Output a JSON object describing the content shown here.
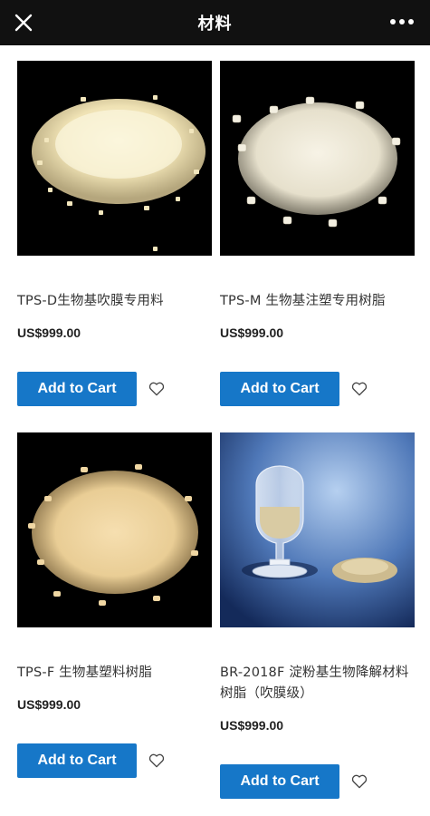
{
  "header": {
    "title": "材料",
    "close_icon": "close-icon",
    "more_icon": "more-horizontal-icon"
  },
  "products": [
    {
      "name": "TPS-D生物基吹膜专用料",
      "price": "US$999.00",
      "button": "Add to Cart",
      "image": "ivory-pellets-on-black"
    },
    {
      "name": "TPS-M 生物基注塑专用树脂",
      "price": "US$999.00",
      "button": "Add to Cart",
      "image": "white-pellets-on-black"
    },
    {
      "name": "TPS-F 生物基塑料树脂",
      "price": "US$999.00",
      "button": "Add to Cart",
      "image": "beige-pellets-on-black"
    },
    {
      "name": "BR-2018F 淀粉基生物降解材料树脂（吹膜级）",
      "price": "US$999.00",
      "button": "Add to Cart",
      "image": "pellets-in-glass-flask-on-blue"
    }
  ],
  "colors": {
    "header_bg": "#111111",
    "button": "#1677c8"
  }
}
